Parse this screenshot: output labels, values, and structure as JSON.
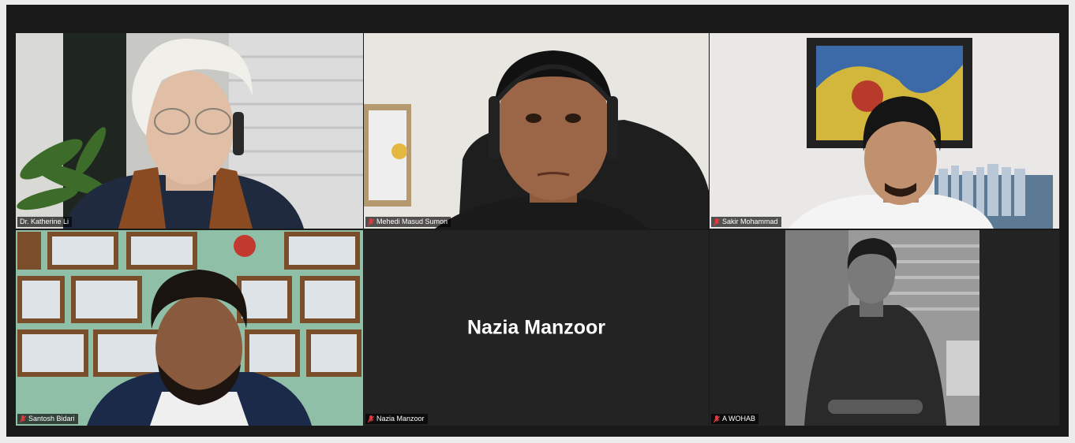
{
  "participants": [
    {
      "name": "Dr. Katherine Li",
      "muted": false,
      "video_on": true,
      "active_speaker": true
    },
    {
      "name": "Mehedi Masud Sumon",
      "muted": true,
      "video_on": true,
      "active_speaker": false
    },
    {
      "name": "Sakir Mohammad",
      "muted": true,
      "video_on": true,
      "active_speaker": false
    },
    {
      "name": "Santosh Bidari",
      "muted": true,
      "video_on": true,
      "active_speaker": false
    },
    {
      "name": "Nazia Manzoor",
      "muted": true,
      "video_on": false,
      "active_speaker": false
    },
    {
      "name": "A WOHAB",
      "muted": true,
      "video_on": true,
      "active_speaker": false
    }
  ],
  "colors": {
    "active_border": "#c9d66a",
    "muted_icon": "#e0383e",
    "tile_bg": "#232323"
  }
}
